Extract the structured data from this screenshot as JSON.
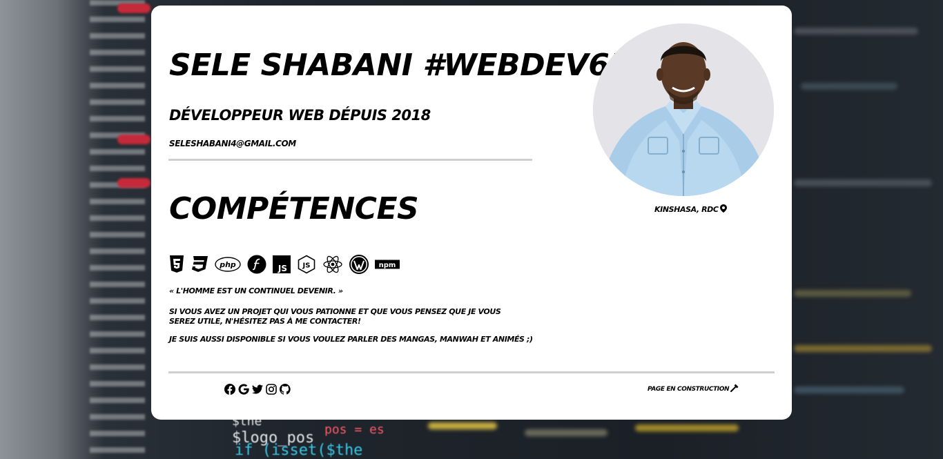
{
  "header": {
    "title": "SELE SHABANI #WEBDEV650",
    "subtitle": "DÉVELOPPEUR WEB DÉPUIS 2018",
    "email": "SELESHABANI4@GMAIL.COM"
  },
  "skills": {
    "title": "COMPÉTENCES",
    "icons": [
      "html5-icon",
      "css3-icon",
      "php-icon",
      "symfony-icon",
      "javascript-icon",
      "nodejs-icon",
      "react-icon",
      "wordpress-icon",
      "npm-icon"
    ],
    "php_label": "php",
    "js_label": "JS",
    "npm_label": "npm"
  },
  "about": {
    "quote": "« L'HOMME EST UN CONTINUEL DEVENIR. »",
    "paragraph1": "SI VOUS AVEZ UN PROJET QUI VOUS PATIONNE ET QUE VOUS PENSEZ QUE JE VOUS SEREZ UTILE, N'HÉSITEZ PAS À ME CONTACTER!",
    "paragraph2": "JE SUIS AUSSI DISPONIBLE SI VOUS VOULEZ PARLER DES MANGAS, MANWAH ET ANIMÉS ;)"
  },
  "profile": {
    "location": "KINSHASA, RDC"
  },
  "footer": {
    "social_icons": [
      "facebook-icon",
      "google-icon",
      "twitter-icon",
      "instagram-icon",
      "github-icon"
    ],
    "construction": "PAGE EN CONSTRUCTION"
  },
  "colors": {
    "card_bg": "#ffffff",
    "text": "#000000",
    "rule": "#cfcfcf"
  },
  "background_code": {
    "line1": "$the",
    "line2": "$logo_pos",
    "line3": "if (isset($the",
    "line4": "pos = es"
  }
}
